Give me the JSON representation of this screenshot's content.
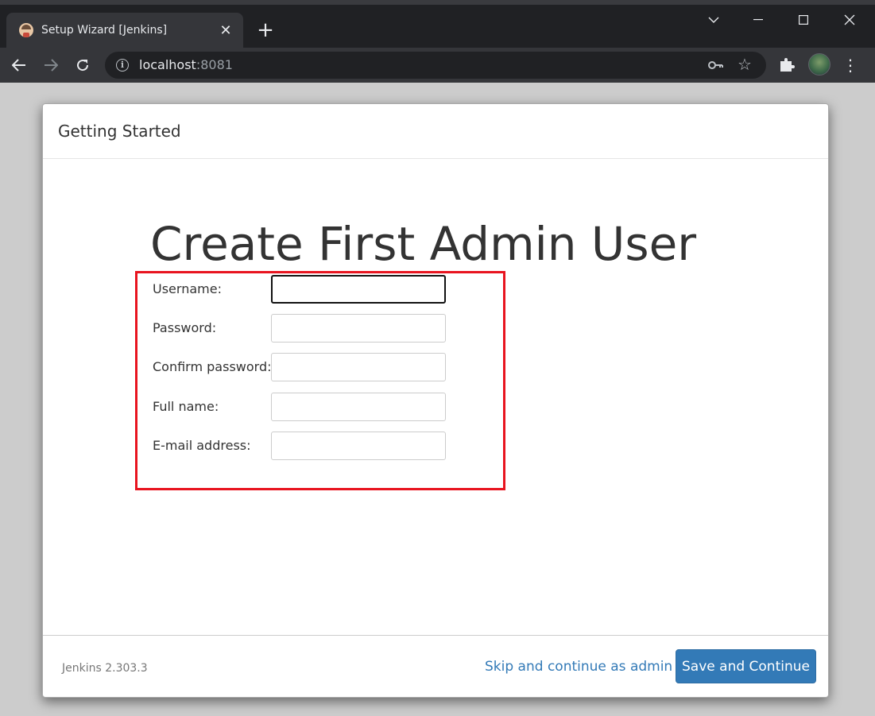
{
  "browser": {
    "tab_title": "Setup Wizard [Jenkins]",
    "url_host": "localhost",
    "url_port": ":8081",
    "icons": [
      "jenkins-favicon",
      "close-icon",
      "plus-icon",
      "chevron-down-icon",
      "minimize-icon",
      "maximize-icon",
      "window-close-icon",
      "back-arrow-icon",
      "forward-arrow-icon",
      "reload-icon",
      "info-icon",
      "key-icon",
      "star-icon",
      "puzzle-icon",
      "profile-avatar",
      "kebab-menu-icon"
    ]
  },
  "dialog": {
    "header_title": "Getting Started",
    "heading": "Create First Admin User",
    "highlight_color": "#e8141f",
    "fields": [
      {
        "label": "Username:",
        "value": ""
      },
      {
        "label": "Password:",
        "value": ""
      },
      {
        "label": "Confirm password:",
        "value": ""
      },
      {
        "label": "Full name:",
        "value": ""
      },
      {
        "label": "E-mail address:",
        "value": ""
      }
    ],
    "footer": {
      "version": "Jenkins 2.303.3",
      "skip_label": "Skip and continue as admin",
      "save_label": "Save and Continue",
      "accent": "#337ab7"
    }
  }
}
